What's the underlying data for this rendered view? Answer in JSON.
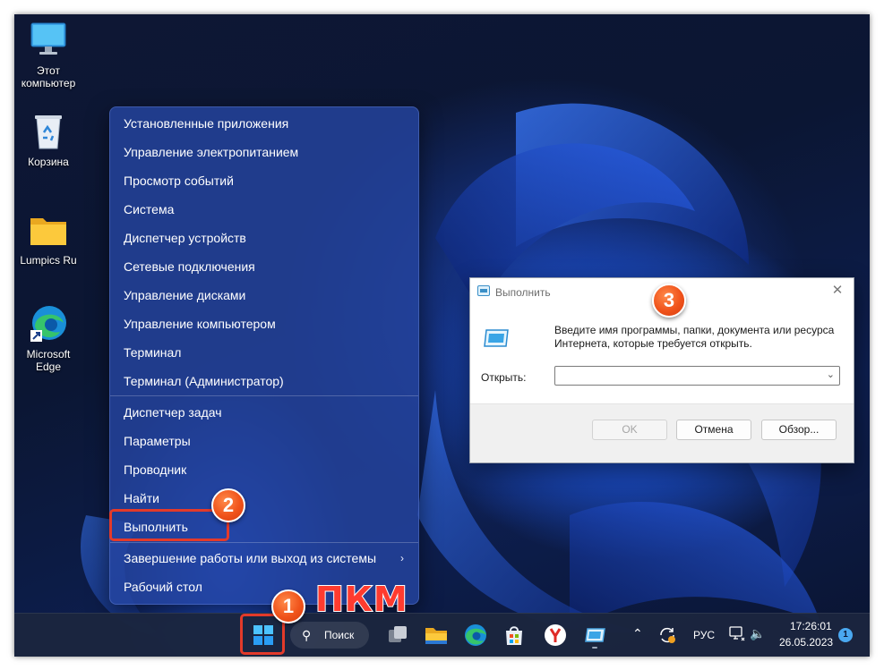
{
  "desktop": {
    "icons": [
      {
        "label_line1": "Этот",
        "label_line2": "компьютер",
        "icon": "monitor-icon"
      },
      {
        "label_line1": "Корзина",
        "label_line2": "",
        "icon": "recycle-bin-icon"
      },
      {
        "label_line1": "Lumpics Ru",
        "label_line2": "",
        "icon": "folder-icon"
      },
      {
        "label_line1": "Microsoft",
        "label_line2": "Edge",
        "icon": "edge-icon"
      }
    ]
  },
  "context_menu": {
    "items": [
      "Установленные приложения",
      "Управление электропитанием",
      "Просмотр событий",
      "Система",
      "Диспетчер устройств",
      "Сетевые подключения",
      "Управление дисками",
      "Управление компьютером",
      "Терминал",
      "Терминал (Администратор)",
      "Диспетчер задач",
      "Параметры",
      "Проводник",
      "Найти",
      "Выполнить",
      "Завершение работы или выход из системы",
      "Рабочий стол"
    ],
    "submenu_chevron": "›"
  },
  "run_dialog": {
    "title": "Выполнить",
    "close": "✕",
    "message": "Введите имя программы, папки, документа или ресурса Интернета, которые требуется открыть.",
    "open_label": "Открыть:",
    "open_value": "",
    "ok_label": "OK",
    "cancel_label": "Отмена",
    "browse_label": "Обзор..."
  },
  "taskbar": {
    "search_label": "Поиск",
    "language": "РУС",
    "time": "17:26:01",
    "date": "26.05.2023",
    "notification_count": "1"
  },
  "annotations": {
    "step1": "1",
    "step2": "2",
    "step3": "3",
    "pkm": "ПКМ",
    "accent_color": "#e33a2a"
  }
}
